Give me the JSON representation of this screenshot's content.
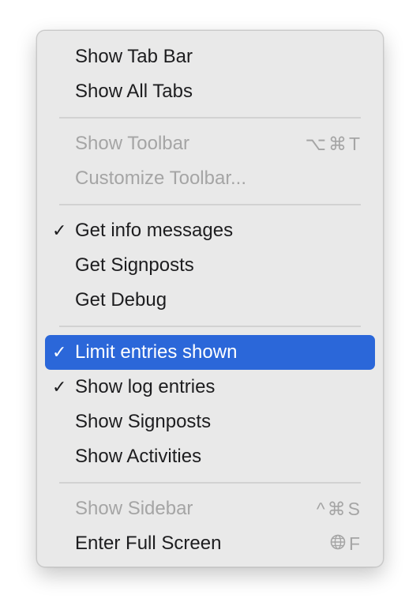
{
  "menu": {
    "groups": [
      {
        "items": [
          {
            "label": "Show Tab Bar",
            "checked": false,
            "enabled": true
          },
          {
            "label": "Show All Tabs",
            "checked": false,
            "enabled": true
          }
        ]
      },
      {
        "items": [
          {
            "label": "Show Toolbar",
            "checked": false,
            "enabled": false,
            "shortcut": "⌥⌘T"
          },
          {
            "label": "Customize Toolbar...",
            "checked": false,
            "enabled": false
          }
        ]
      },
      {
        "items": [
          {
            "label": "Get info messages",
            "checked": true,
            "enabled": true
          },
          {
            "label": "Get Signposts",
            "checked": false,
            "enabled": true
          },
          {
            "label": "Get Debug",
            "checked": false,
            "enabled": true
          }
        ]
      },
      {
        "items": [
          {
            "label": "Limit entries shown",
            "checked": true,
            "enabled": true,
            "highlighted": true
          },
          {
            "label": "Show log entries",
            "checked": true,
            "enabled": true
          },
          {
            "label": "Show Signposts",
            "checked": false,
            "enabled": true
          },
          {
            "label": "Show Activities",
            "checked": false,
            "enabled": true
          }
        ]
      },
      {
        "items": [
          {
            "label": "Show Sidebar",
            "checked": false,
            "enabled": false,
            "shortcut": "^⌘S"
          },
          {
            "label": "Enter Full Screen",
            "checked": false,
            "enabled": true,
            "shortcut": "F",
            "shortcut_icon": "globe-icon"
          }
        ]
      }
    ],
    "check_mark": "✓",
    "colors": {
      "highlight": "#2b67d9",
      "menu_background": "#e9e9e9",
      "disabled_text": "#a5a5a5",
      "shortcut_text": "#a5a5a5"
    }
  }
}
